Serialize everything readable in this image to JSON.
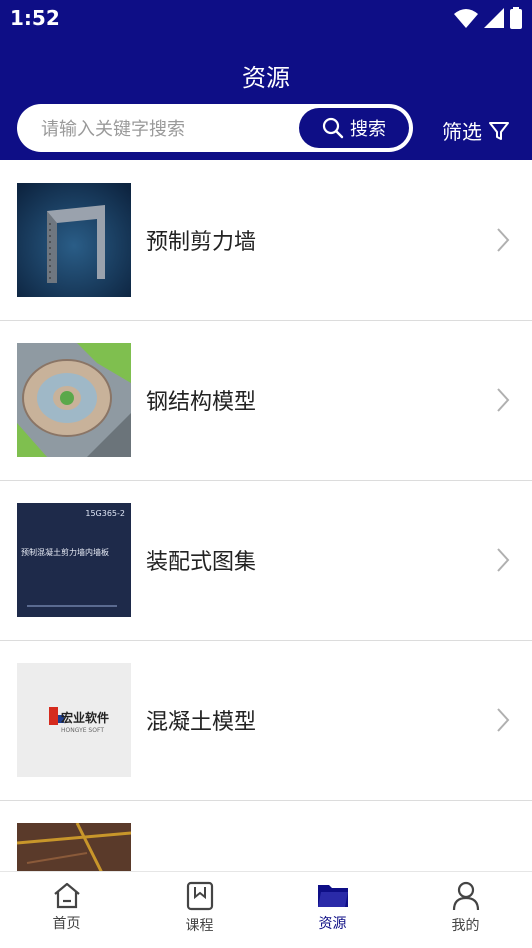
{
  "status": {
    "time": "1:52"
  },
  "header": {
    "title": "资源"
  },
  "search": {
    "placeholder": "请输入关键字搜索",
    "button_label": "搜索"
  },
  "filter": {
    "label": "筛选"
  },
  "items": [
    {
      "label": "预制剪力墙",
      "thumb_icon": "precast-wall-render-icon"
    },
    {
      "label": "钢结构模型",
      "thumb_icon": "steel-structure-aerial-icon"
    },
    {
      "label": "装配式图集",
      "thumb_icon": "atlas-cover-icon",
      "thumb_code": "15G365-2",
      "thumb_title": "预制混凝土剪力墙内墙板"
    },
    {
      "label": "混凝土模型",
      "thumb_icon": "company-logo-icon",
      "thumb_logo": "宏业软件",
      "thumb_sub": "HONGYE SOFT"
    },
    {
      "label": "",
      "thumb_icon": "building-render-icon"
    }
  ],
  "nav": [
    {
      "label": "首页",
      "icon": "home-icon"
    },
    {
      "label": "课程",
      "icon": "course-bookmark-icon"
    },
    {
      "label": "资源",
      "icon": "folder-icon",
      "active": true
    },
    {
      "label": "我的",
      "icon": "person-icon"
    }
  ],
  "colors": {
    "primary": "#0e0e86",
    "divider": "#dcdcdc"
  }
}
